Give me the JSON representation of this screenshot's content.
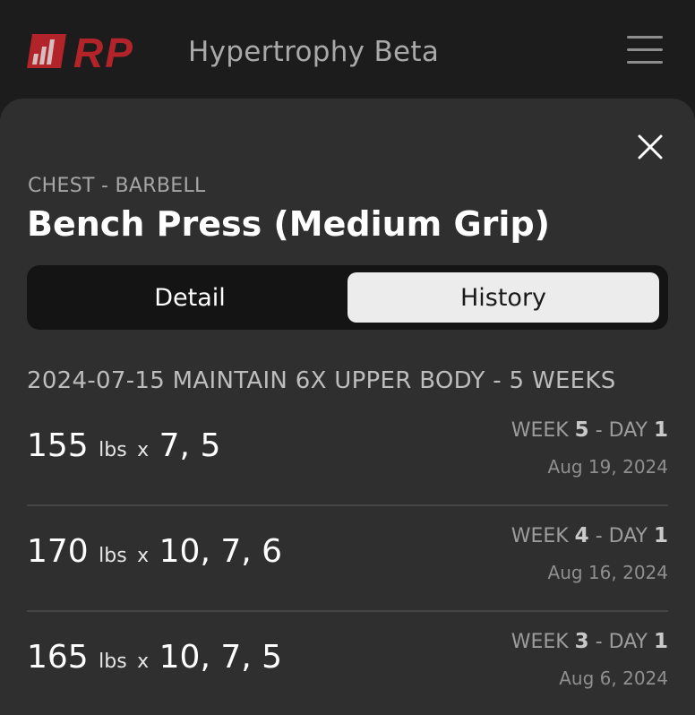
{
  "header": {
    "logo_text": "RP",
    "app_title": "Hypertrophy Beta"
  },
  "exercise": {
    "category": "CHEST - BARBELL",
    "name": "Bench Press (Medium Grip)"
  },
  "tabs": {
    "detail": "Detail",
    "history": "History",
    "selected": "History"
  },
  "history": {
    "mesocycle": "2024-07-15 MAINTAIN 6X UPPER BODY - 5 WEEKS",
    "entries": [
      {
        "weight": "155",
        "unit": "lbs",
        "x": "x",
        "reps": "7,  5",
        "week_label": "WEEK",
        "week": "5",
        "sep": "-",
        "day_label": "DAY",
        "day": "1",
        "date": "Aug 19, 2024"
      },
      {
        "weight": "170",
        "unit": "lbs",
        "x": "x",
        "reps": "10,  7,  6",
        "week_label": "WEEK",
        "week": "4",
        "sep": "-",
        "day_label": "DAY",
        "day": "1",
        "date": "Aug 16, 2024"
      },
      {
        "weight": "165",
        "unit": "lbs",
        "x": "x",
        "reps": "10,  7,  5",
        "week_label": "WEEK",
        "week": "3",
        "sep": "-",
        "day_label": "DAY",
        "day": "1",
        "date": "Aug 6, 2024"
      }
    ]
  },
  "colors": {
    "brand_red": "#c1272d",
    "sheet_bg": "#2f2f2f",
    "page_bg": "#1c1c1c"
  }
}
